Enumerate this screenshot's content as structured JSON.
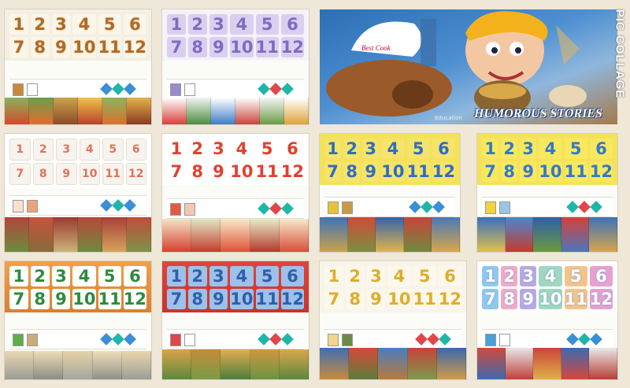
{
  "numbers": [
    "1",
    "2",
    "3",
    "4",
    "5",
    "6",
    "7",
    "8",
    "9",
    "10",
    "11",
    "12"
  ],
  "hero": {
    "title": "HUMOROUS STORIES",
    "subtitle": "Education",
    "hat_text": "Best Cook"
  },
  "watermark": "PIC COLLAGE",
  "colors": {
    "background": "#efe7d8",
    "chevron_blue": "#3a8fd6",
    "chevron_teal": "#1fb6a8",
    "chevron_red": "#e2454a"
  },
  "panels": [
    {
      "id": "cookie-numbers",
      "style": "cookie"
    },
    {
      "id": "purple-sign-numbers",
      "style": "sign"
    },
    {
      "id": "dot-domino-numbers",
      "style": "dots"
    },
    {
      "id": "red-bead-numbers",
      "style": "beads"
    },
    {
      "id": "yellow-people-numbers",
      "style": "people"
    },
    {
      "id": "blue-yellow-numbers",
      "style": "blue"
    },
    {
      "id": "orange-elephant-numbers",
      "style": "elephant"
    },
    {
      "id": "blue-mouse-numbers",
      "style": "mouse"
    },
    {
      "id": "gold-pasta-numbers",
      "style": "pasta"
    },
    {
      "id": "pink-cloud-numbers",
      "style": "cloud"
    }
  ]
}
